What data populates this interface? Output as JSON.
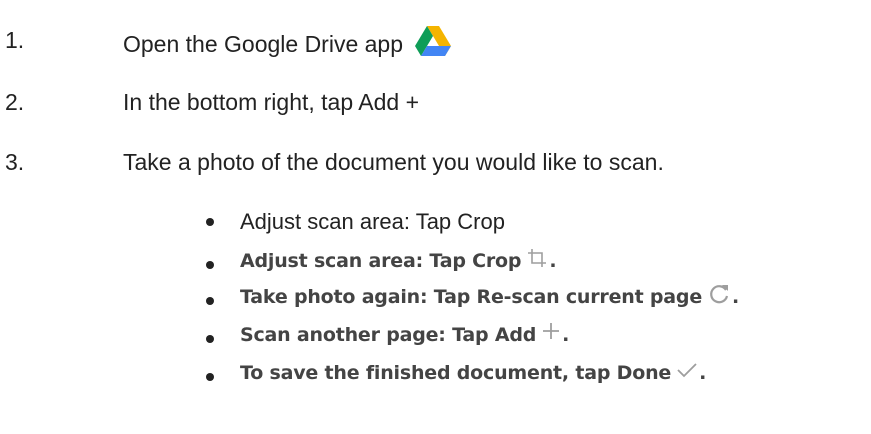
{
  "steps": [
    {
      "number": "1.",
      "text": "Open the Google Drive app",
      "icon": "google-drive-icon"
    },
    {
      "number": "2.",
      "text": "In the bottom right, tap Add +"
    },
    {
      "number": "3.",
      "text": "Take a photo of the document you would like to scan."
    }
  ],
  "bullets": [
    {
      "text": "Adjust scan area: Tap Crop"
    },
    {
      "text": "Adjust scan area: Tap Crop",
      "icon": "crop-icon",
      "suffix": "."
    },
    {
      "text": "Take photo again: Tap Re-scan current page",
      "icon": "refresh-icon",
      "suffix": "."
    },
    {
      "text": "Scan another page: Tap Add",
      "icon": "plus-icon",
      "suffix": "."
    },
    {
      "text": "To save the finished document, tap Done",
      "icon": "checkmark-icon",
      "suffix": "."
    }
  ],
  "colors": {
    "text": "#222222",
    "bold_text": "#444444",
    "icon_gray": "#9e9e9e",
    "drive_green": "#0F9D58",
    "drive_yellow": "#F4B400",
    "drive_blue": "#4285F4"
  }
}
